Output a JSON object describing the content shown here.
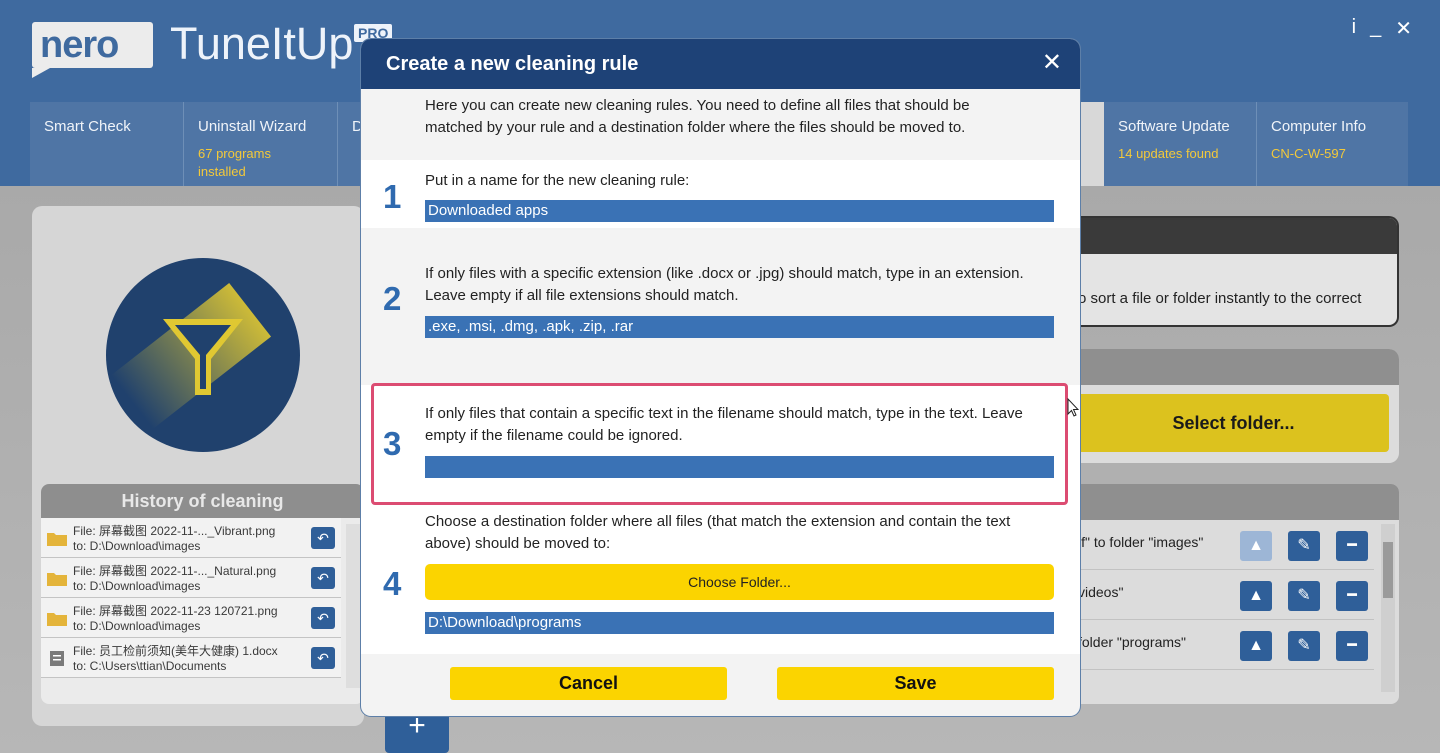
{
  "app": {
    "logo": "nero",
    "name": "TuneItUp",
    "badge": "PRO",
    "window_controls": {
      "info": "i",
      "minimize": "_",
      "close": "✕"
    }
  },
  "nav": [
    {
      "label": "Smart Check",
      "sub": ""
    },
    {
      "label": "Uninstall Wizard",
      "sub": "67 programs installed"
    },
    {
      "label": "D",
      "sub": ""
    },
    {
      "label": "Software Update",
      "sub": "14 updates found"
    },
    {
      "label": "Computer Info",
      "sub": "CN-C-W-597"
    }
  ],
  "history": {
    "title": "History of cleaning",
    "items": [
      {
        "icon": "folder-icon",
        "line1": "File: 屏幕截图 2022-11-..._Vibrant.png",
        "line2": "to: D:\\Download\\images"
      },
      {
        "icon": "folder-icon",
        "line1": "File: 屏幕截图 2022-11-..._Natural.png",
        "line2": "to: D:\\Download\\images"
      },
      {
        "icon": "folder-icon",
        "line1": "File: 屏幕截图 2022-11-23 120721.png",
        "line2": "to: D:\\Download\\images"
      },
      {
        "icon": "document-icon",
        "line1": "File: 员工检前须知(美年大健康) 1.docx",
        "line2": "to: C:\\Users\\ttian\\Documents"
      }
    ]
  },
  "right_panel": {
    "instant_sort_text": "o sort a file or folder instantly to the correct",
    "select_folder_label": "Select folder...",
    "rules": [
      {
        "text": "if\" to folder \"images\""
      },
      {
        "text": "videos\""
      },
      {
        "text": "folder \"programs\""
      }
    ]
  },
  "add_button_label": "+",
  "modal": {
    "title": "Create a new cleaning rule",
    "close_label": "✕",
    "intro": "Here you can create new cleaning rules. You need to define all files that should be matched by your rule and a destination folder where the files should be moved to.",
    "steps": [
      {
        "number": "1",
        "text": "Put in a name for the new cleaning rule:",
        "value": "Downloaded apps"
      },
      {
        "number": "2",
        "text": "If only files with a specific extension (like .docx or .jpg) should match, type in an extension. Leave empty if all file extensions should match.",
        "value": ".exe, .msi, .dmg, .apk, .zip, .rar"
      },
      {
        "number": "3",
        "text": "If only files that contain a specific text in the filename should match, type in the text. Leave empty if the filename could be ignored.",
        "value": ""
      },
      {
        "number": "4",
        "text": "Choose a destination folder where all files (that match the extension and contain the text above) should be moved to:",
        "button": "Choose Folder...",
        "value": "D:\\Download\\programs"
      }
    ],
    "cancel_label": "Cancel",
    "save_label": "Save"
  },
  "colors": {
    "header_blue": "#1e4277",
    "field_blue": "#3a72b5",
    "accent_yellow": "#fbd400",
    "highlight_pink": "#dc4c72"
  }
}
